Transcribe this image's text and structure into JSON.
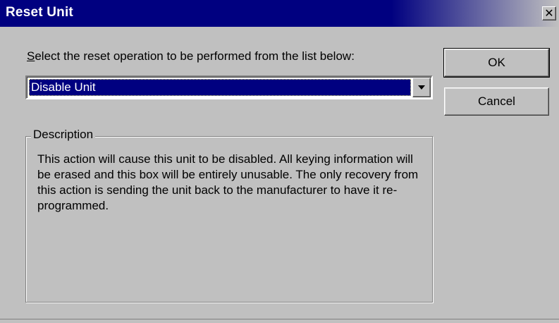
{
  "window": {
    "title": "Reset Unit",
    "close_glyph": "✕",
    "title_bar_color": "#000080",
    "face_color": "#c0c0c0"
  },
  "prompt": {
    "accelerator": "S",
    "rest": "elect the reset operation to be performed from the list below:"
  },
  "reset_operation": {
    "selected": "Disable Unit",
    "arrow_icon": "chevron-down-icon"
  },
  "buttons": {
    "ok": "OK",
    "cancel": "Cancel"
  },
  "description": {
    "legend": "Description",
    "text": "This action will cause this unit to be disabled. All keying information will be erased and this box will be entirely unusable. The only recovery from this action is sending the unit back to the manufacturer to have it re-programmed."
  }
}
